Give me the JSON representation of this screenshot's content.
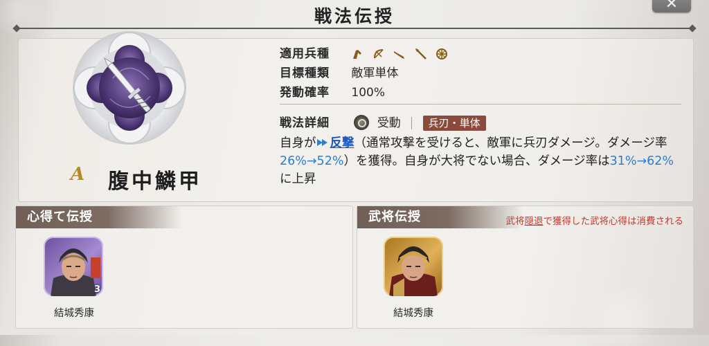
{
  "header": {
    "title": "戦法伝授",
    "close_label": "✕"
  },
  "skill": {
    "rank": "A",
    "name": "腹中鱗甲",
    "icon": "dagger-emblem-icon",
    "info": [
      {
        "label": "適用兵種",
        "value": ""
      },
      {
        "label": "目標種類",
        "value": "敵軍単体"
      },
      {
        "label": "発動確率",
        "value": "100%"
      }
    ],
    "unit_icons": [
      "cavalry-icon",
      "bow-icon",
      "gun-icon",
      "spear-icon",
      "wheel-icon"
    ],
    "detail": {
      "label": "戦法詳細",
      "kind": "受動",
      "type_badge": "兵刃・単体"
    },
    "description": {
      "p1": "自身が",
      "link": "反撃",
      "p2": "（通常攻撃を受けると、敵軍に兵刃ダメージ。ダメージ率",
      "num1": "26%→52%",
      "p3": "）を獲得。自身が大将でない場合、ダメージ率は",
      "num2": "31%→62%",
      "p4": "に上昇"
    }
  },
  "panels": {
    "left": {
      "title": "心得て伝授",
      "general_name": "結城秀康",
      "count": "3"
    },
    "right": {
      "title": "武将伝授",
      "general_name": "結城秀康",
      "note_pre": "武将",
      "note_link": "隠退",
      "note_post": "で獲得した武将心得は消費される"
    }
  },
  "colors": {
    "accent_blue": "#2a7fd0",
    "badge": "#8a4b3c",
    "warning": "#c8372a",
    "rank_gold": "#b58a1e"
  }
}
